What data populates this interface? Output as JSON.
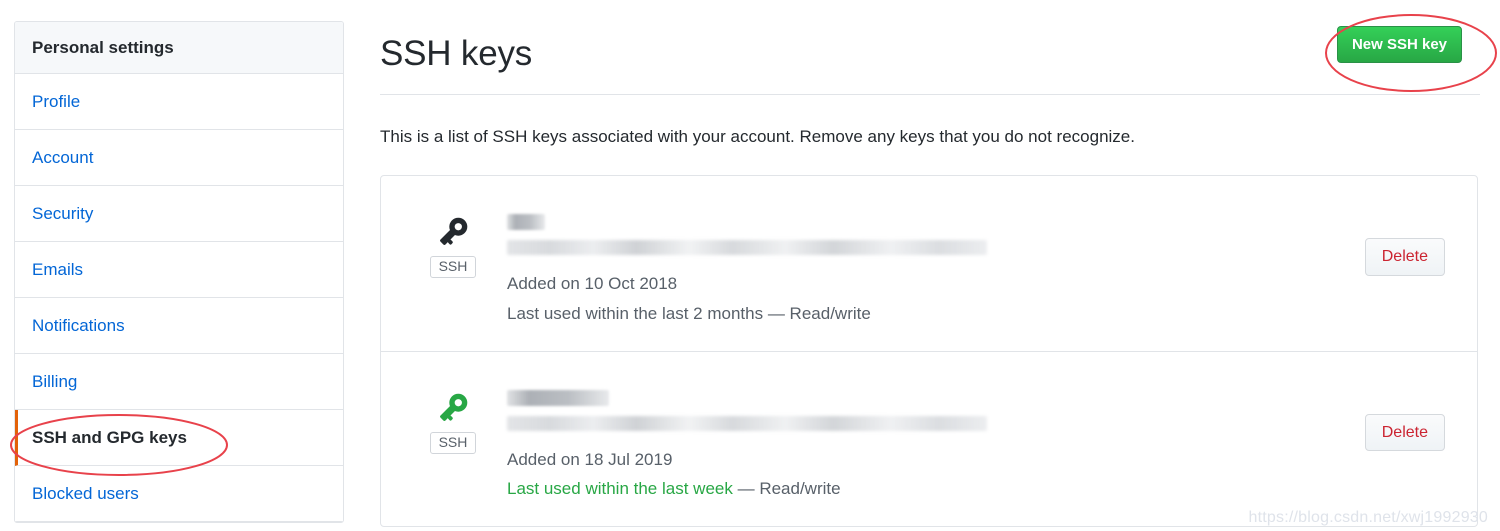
{
  "sidebar": {
    "header": "Personal settings",
    "items": [
      {
        "label": "Profile",
        "active": false
      },
      {
        "label": "Account",
        "active": false
      },
      {
        "label": "Security",
        "active": false
      },
      {
        "label": "Emails",
        "active": false
      },
      {
        "label": "Notifications",
        "active": false
      },
      {
        "label": "Billing",
        "active": false
      },
      {
        "label": "SSH and GPG keys",
        "active": true
      },
      {
        "label": "Blocked users",
        "active": false
      }
    ]
  },
  "main": {
    "title": "SSH keys",
    "new_key_button": "New SSH key",
    "description": "This is a list of SSH keys associated with your account. Remove any keys that you do not recognize.",
    "keys": [
      {
        "icon": "key-icon",
        "icon_color": "#24292e",
        "badge": "SSH",
        "title": "",
        "fingerprint": "",
        "added": "Added on 10 Oct 2018",
        "last_used": "Last used within the last 2 months",
        "last_used_color": "#586069",
        "permission": "— Read/write",
        "delete_label": "Delete"
      },
      {
        "icon": "key-icon",
        "icon_color": "#28a745",
        "badge": "SSH",
        "title": "",
        "fingerprint": "",
        "added": "Added on 18 Jul 2019",
        "last_used": "Last used within the last week",
        "last_used_color": "#28a745",
        "permission": "— Read/write",
        "delete_label": "Delete"
      }
    ]
  },
  "annotations": {
    "color": "#e8424b",
    "shapes": [
      "ellipse-around-ssh-and-gpg-keys",
      "ellipse-around-new-ssh-key-button"
    ]
  },
  "watermark": "https://blog.csdn.net/xwj1992930",
  "colors": {
    "link": "#0366d6",
    "active_marker": "#e36209",
    "green": "#28a745",
    "danger": "#cb2431",
    "border": "#e1e4e8",
    "muted_text": "#586069",
    "header_bg": "#f6f8fa"
  }
}
